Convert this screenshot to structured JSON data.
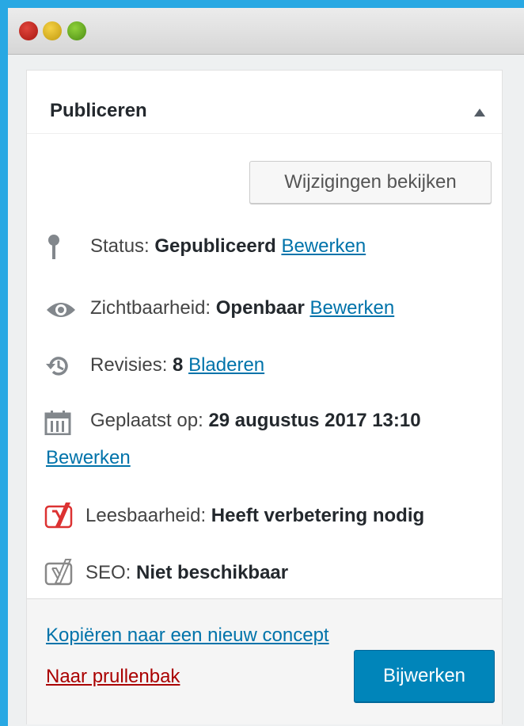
{
  "metabox": {
    "title": "Publiceren",
    "collapse_icon": "triangle-up-icon"
  },
  "preview_button": "Wijzigingen bekijken",
  "status": {
    "label": "Status:",
    "value": "Gepubliceerd",
    "link": "Bewerken",
    "icon": "pin-icon"
  },
  "visibility": {
    "label": "Zichtbaarheid:",
    "value": "Openbaar",
    "link": "Bewerken",
    "icon": "eye-icon"
  },
  "revisions": {
    "label": "Revisies:",
    "value": "8",
    "link": "Bladeren",
    "icon": "history-icon"
  },
  "published": {
    "label": "Geplaatst op:",
    "value": "29 augustus 2017 13:10",
    "link": "Bewerken",
    "icon": "calendar-icon"
  },
  "readability": {
    "label": "Leesbaarheid:",
    "value": "Heeft verbetering nodig",
    "icon": "yoast-readability-icon",
    "color": "#dc3232"
  },
  "seo": {
    "label": "SEO:",
    "value": "Niet beschikbaar",
    "icon": "yoast-seo-icon",
    "color": "#666666"
  },
  "footer": {
    "copy_link": "Kopiëren naar een nieuw concept",
    "trash_link": "Naar prullenbak",
    "update_button": "Bijwerken"
  },
  "colors": {
    "accent": "#0085ba",
    "link": "#0073aa",
    "trash": "#aa0000",
    "background": "#28a8e3"
  }
}
